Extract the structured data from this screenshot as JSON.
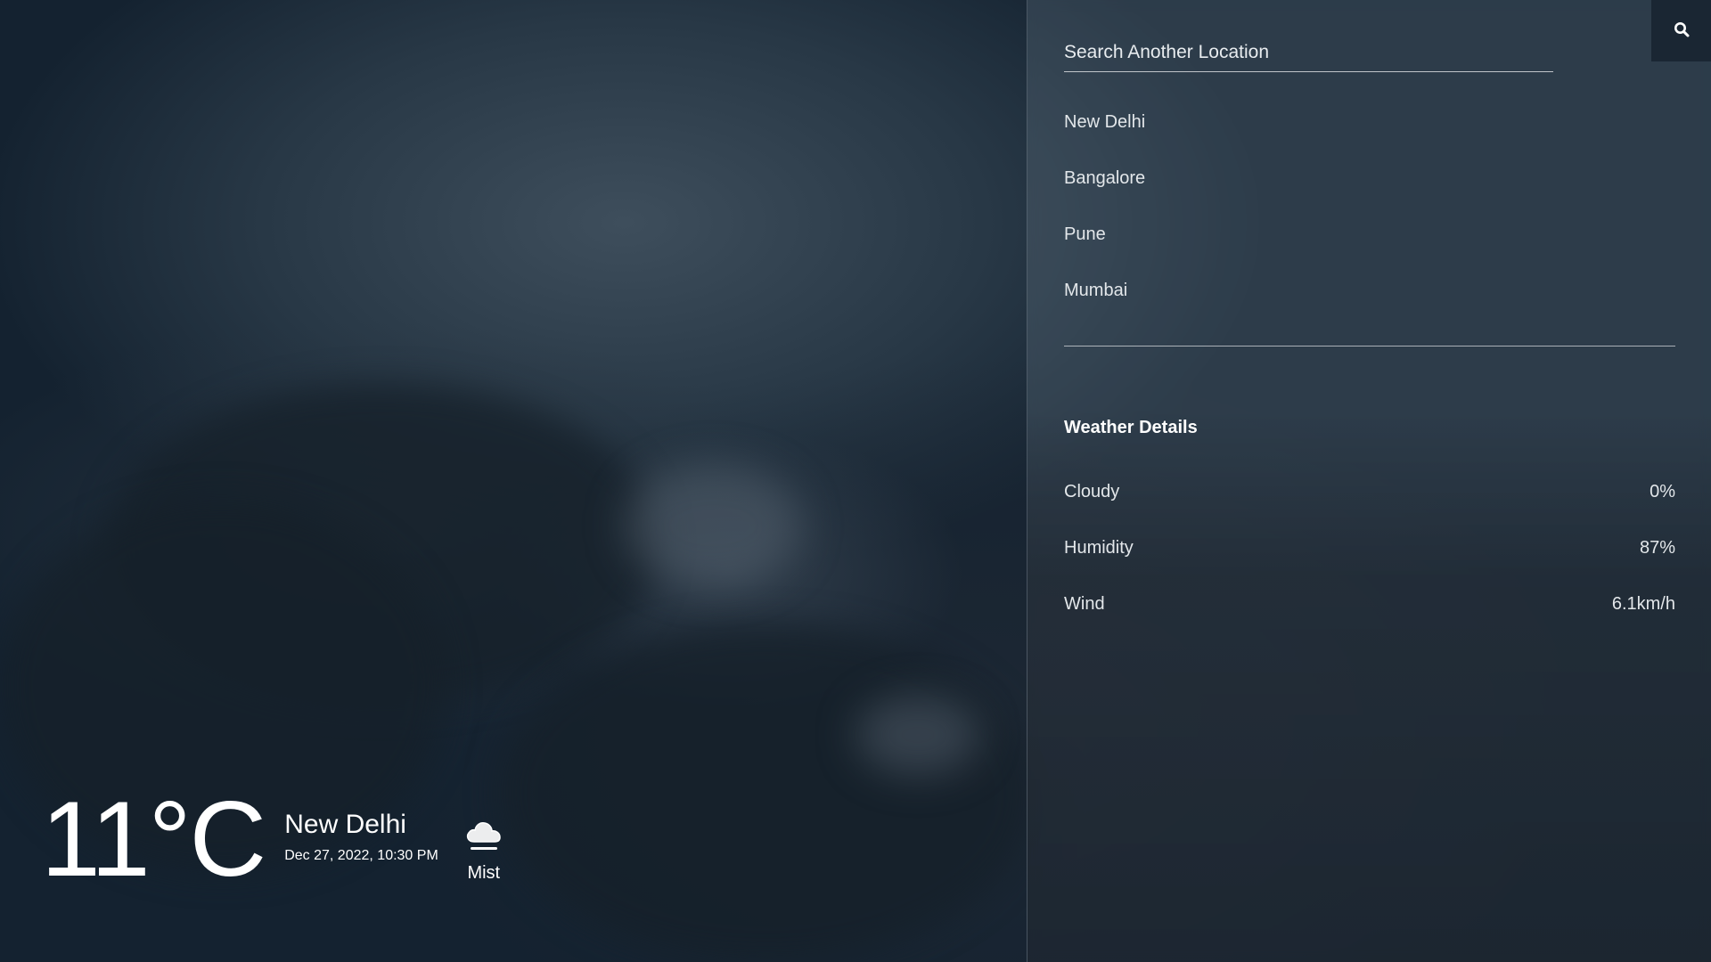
{
  "current": {
    "temperature": "11°C",
    "city": "New Delhi",
    "datetime": "Dec 27, 2022, 10:30 PM",
    "condition": "Mist",
    "condition_icon": "cloud-mist-icon"
  },
  "search": {
    "placeholder": "Search Another Location",
    "button_icon": "search-icon"
  },
  "cities": [
    {
      "label": "New Delhi"
    },
    {
      "label": "Bangalore"
    },
    {
      "label": "Pune"
    },
    {
      "label": "Mumbai"
    }
  ],
  "details": {
    "title": "Weather Details",
    "rows": [
      {
        "label": "Cloudy",
        "value": "0%"
      },
      {
        "label": "Humidity",
        "value": "87%"
      },
      {
        "label": "Wind",
        "value": "6.1km/h"
      }
    ]
  },
  "colors": {
    "background_dark": "#142230",
    "panel_tint": "#6e808e",
    "search_button_bg": "#1a2633",
    "text": "#ffffff"
  }
}
